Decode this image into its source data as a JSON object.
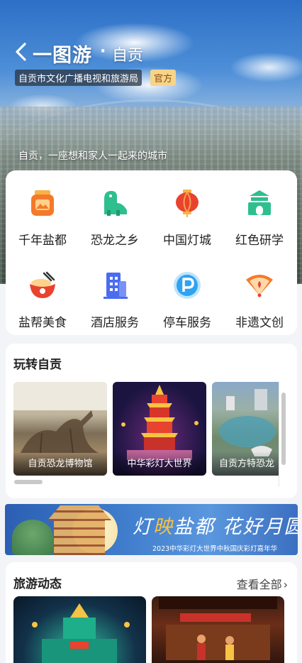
{
  "header": {
    "title": "一图游",
    "dot": "·",
    "subtitle": "自贡",
    "org": "自贡市文化广播电视和旅游局",
    "official": "官方",
    "slogan": "自贡，一座想和家人一起来的城市"
  },
  "categories": [
    {
      "label": "千年盐都",
      "icon": "salt-jar-icon"
    },
    {
      "label": "恐龙之乡",
      "icon": "dinosaur-icon"
    },
    {
      "label": "中国灯城",
      "icon": "lantern-icon"
    },
    {
      "label": "红色研学",
      "icon": "memorial-hall-icon"
    },
    {
      "label": "盐帮美食",
      "icon": "food-bowl-icon"
    },
    {
      "label": "酒店服务",
      "icon": "hotel-building-icon"
    },
    {
      "label": "停车服务",
      "icon": "parking-icon"
    },
    {
      "label": "非遗文创",
      "icon": "fan-icon"
    }
  ],
  "play": {
    "title": "玩转自贡",
    "items": [
      {
        "caption": "自贡恐龙博物馆"
      },
      {
        "caption": "中华彩灯大世界"
      },
      {
        "caption": "自贡方特恐龙"
      }
    ]
  },
  "banner": {
    "headline_a": "灯",
    "headline_b": "映",
    "headline_c": "盐都 花好月圆",
    "subline": "2023中华彩灯大世界中秋国庆彩灯嘉年华"
  },
  "news": {
    "title": "旅游动态",
    "see_all": "查看全部",
    "chevron": "›"
  },
  "colors": {
    "accent_orange": "#f47a2a",
    "accent_green": "#2fbf8f",
    "accent_red": "#e8432f",
    "accent_blue": "#4a6cf0"
  }
}
